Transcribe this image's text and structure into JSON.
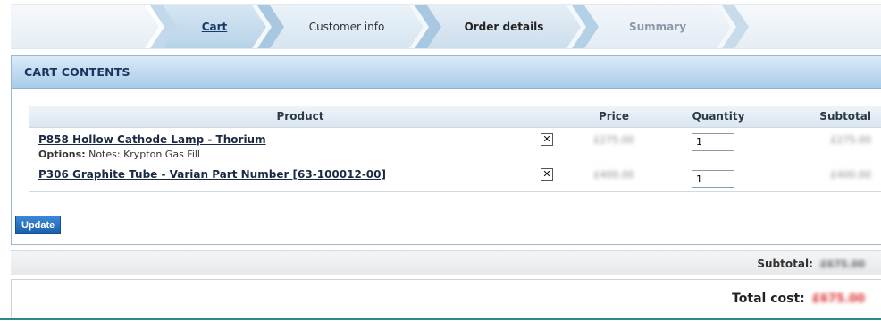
{
  "steps": [
    {
      "label": "Cart",
      "state": "active"
    },
    {
      "label": "Customer info",
      "state": "normal"
    },
    {
      "label": "Order details",
      "state": "current"
    },
    {
      "label": "Summary",
      "state": "pending"
    }
  ],
  "panel": {
    "title": "CART CONTENTS"
  },
  "table": {
    "headers": {
      "product": "Product",
      "price": "Price",
      "quantity": "Quantity",
      "subtotal": "Subtotal"
    },
    "rows": [
      {
        "product": "P858 Hollow Cathode Lamp - Thorium",
        "options_label": "Options:",
        "options_value": "Notes: Krypton Gas Fill",
        "remove": "✕",
        "price": "£275.00",
        "quantity": "1",
        "subtotal": "£275.00"
      },
      {
        "product": "P306 Graphite Tube - Varian Part Number [63-100012-00]",
        "remove": "✕",
        "price": "£400.00",
        "quantity": "1",
        "subtotal": "£400.00"
      }
    ]
  },
  "buttons": {
    "update": "Update"
  },
  "totals": {
    "subtotal_label": "Subtotal:",
    "subtotal_value": "£675.00",
    "total_label": "Total cost:",
    "total_value": "£675.00"
  },
  "colors": {
    "accent": "#1a5fab",
    "header": "#a9cce9",
    "total": "#d33333"
  }
}
